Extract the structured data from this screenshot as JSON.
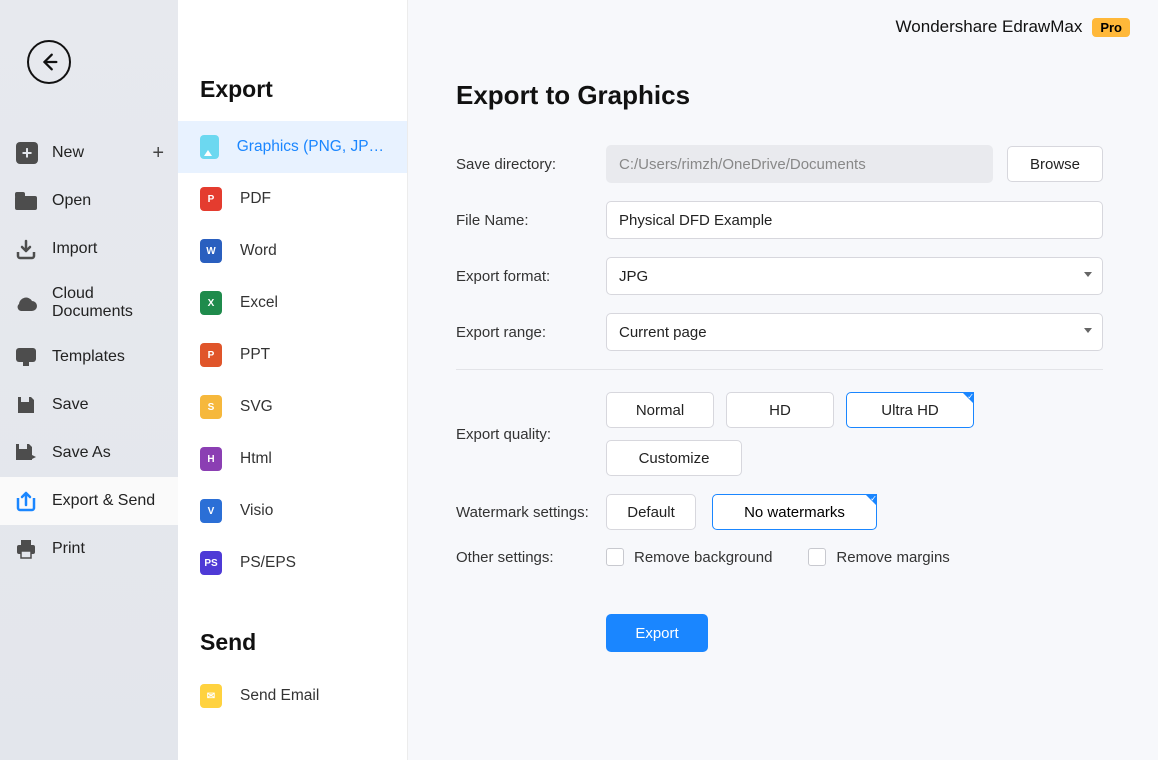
{
  "app": {
    "title": "Wondershare EdrawMax",
    "badge": "Pro"
  },
  "sidebar": {
    "items": [
      {
        "label": "New"
      },
      {
        "label": "Open"
      },
      {
        "label": "Import"
      },
      {
        "label": "Cloud Documents"
      },
      {
        "label": "Templates"
      },
      {
        "label": "Save"
      },
      {
        "label": "Save As"
      },
      {
        "label": "Export & Send"
      },
      {
        "label": "Print"
      }
    ]
  },
  "export_list": {
    "heading": "Export",
    "items": [
      {
        "label": "Graphics (PNG, JPG et..."
      },
      {
        "label": "PDF"
      },
      {
        "label": "Word"
      },
      {
        "label": "Excel"
      },
      {
        "label": "PPT"
      },
      {
        "label": "SVG"
      },
      {
        "label": "Html"
      },
      {
        "label": "Visio"
      },
      {
        "label": "PS/EPS"
      }
    ],
    "send_heading": "Send",
    "send_items": [
      {
        "label": "Send Email"
      }
    ]
  },
  "main": {
    "heading": "Export to Graphics",
    "labels": {
      "save_dir": "Save directory:",
      "file_name": "File Name:",
      "format": "Export format:",
      "range": "Export range:",
      "quality": "Export quality:",
      "watermark": "Watermark settings:",
      "other": "Other settings:"
    },
    "values": {
      "save_dir": "C:/Users/rimzh/OneDrive/Documents",
      "file_name": "Physical DFD Example",
      "format": "JPG",
      "range": "Current page"
    },
    "buttons": {
      "browse": "Browse",
      "customize": "Customize",
      "export": "Export"
    },
    "quality": {
      "normal": "Normal",
      "hd": "HD",
      "ultra": "Ultra HD"
    },
    "watermark": {
      "default": "Default",
      "none": "No watermarks"
    },
    "checks": {
      "remove_bg": "Remove background",
      "remove_margins": "Remove margins"
    }
  }
}
